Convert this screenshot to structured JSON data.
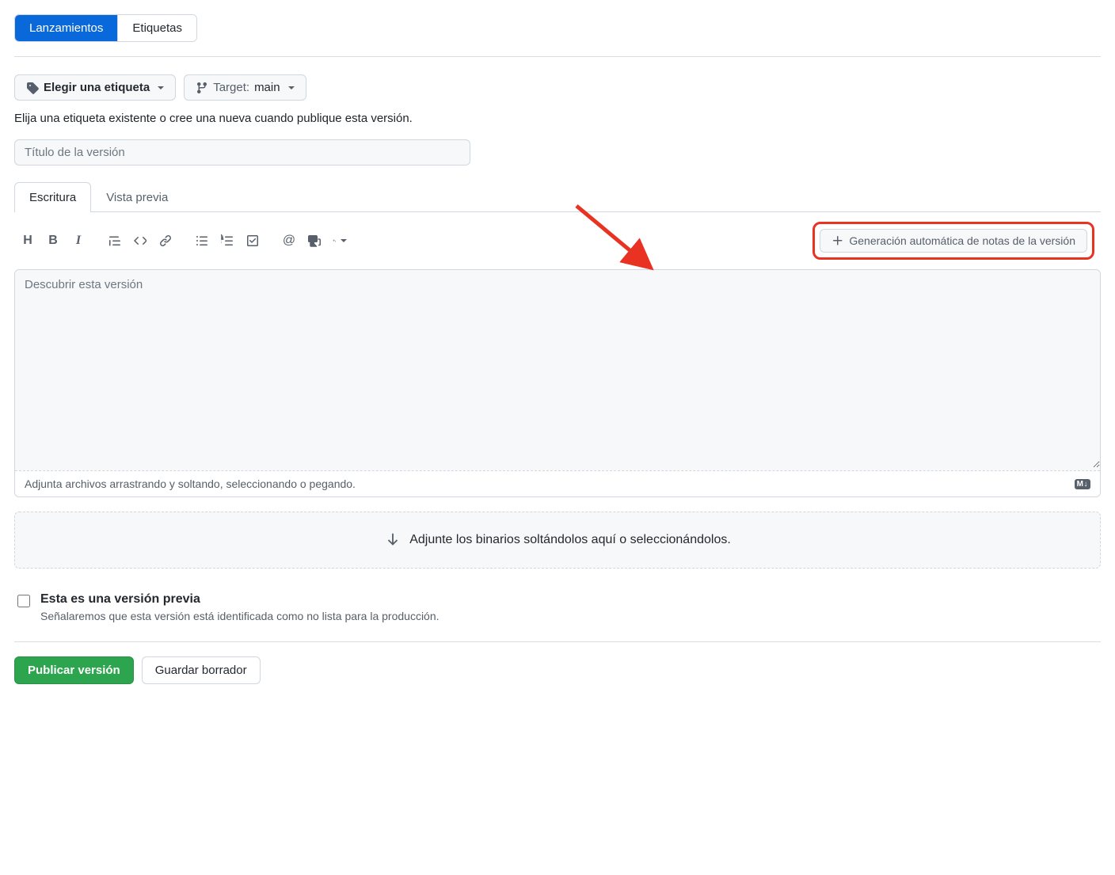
{
  "nav": {
    "releases": "Lanzamientos",
    "tags": "Etiquetas"
  },
  "tag_selector": {
    "choose_tag": "Elegir una etiqueta",
    "target_label": "Target:",
    "target_branch": "main",
    "help": "Elija una etiqueta existente o cree una nueva cuando publique esta versión."
  },
  "title_placeholder": "Título de la versión",
  "editor": {
    "write_tab": "Escritura",
    "preview_tab": "Vista previa",
    "autogen_button": "Generación automática de notas de la versión",
    "desc_placeholder": "Descubrir esta versión",
    "attach_hint": "Adjunta archivos arrastrando y soltando, seleccionando o pegando.",
    "md_badge": "M↓"
  },
  "binaries_drop": "Adjunte los binarios soltándolos aquí o seleccionándolos.",
  "prerelease": {
    "label": "Esta es una versión previa",
    "desc": "Señalaremos que esta versión está identificada como no lista para la producción."
  },
  "footer": {
    "publish": "Publicar versión",
    "draft": "Guardar borrador"
  }
}
